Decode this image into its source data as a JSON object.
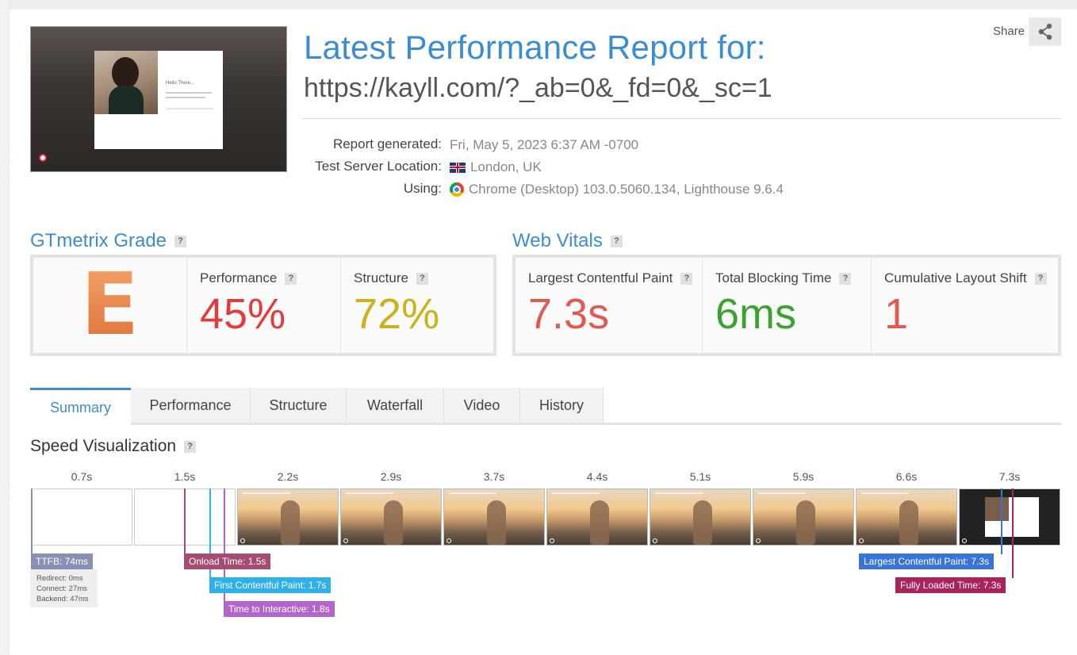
{
  "header": {
    "title": "Latest Performance Report for:",
    "url": "https://kayll.com/?_ab=0&_fd=0&_sc=1",
    "share_label": "Share",
    "thumbnail_text": "Hello There..."
  },
  "meta": {
    "report_generated_label": "Report generated:",
    "report_generated_value": "Fri, May 5, 2023 6:37 AM -0700",
    "location_label": "Test Server Location:",
    "location_value": "London, UK",
    "using_label": "Using:",
    "using_value": "Chrome (Desktop) 103.0.5060.134, Lighthouse 9.6.4"
  },
  "gtmetrix": {
    "title": "GTmetrix Grade",
    "grade": "E",
    "performance_label": "Performance",
    "performance_value": "45%",
    "structure_label": "Structure",
    "structure_value": "72%"
  },
  "web_vitals": {
    "title": "Web Vitals",
    "lcp_label": "Largest Contentful Paint",
    "lcp_value": "7.3s",
    "tbt_label": "Total Blocking Time",
    "tbt_value": "6ms",
    "cls_label": "Cumulative Layout Shift",
    "cls_value": "1"
  },
  "tabs": [
    "Summary",
    "Performance",
    "Structure",
    "Waterfall",
    "Video",
    "History"
  ],
  "speed": {
    "title": "Speed Visualization",
    "frame_times": [
      "0.7s",
      "1.5s",
      "2.2s",
      "2.9s",
      "3.7s",
      "4.4s",
      "5.1s",
      "5.9s",
      "6.6s",
      "7.3s"
    ],
    "ttfb": "TTFB: 74ms",
    "redirect": "Redirect: 0ms",
    "connect": "Connect: 27ms",
    "backend": "Backend: 47ms",
    "onload": "Onload Time: 1.5s",
    "fcp": "First Contentful Paint: 1.7s",
    "tti": "Time to Interactive: 1.8s",
    "lcp": "Largest Contentful Paint: 7.3s",
    "fully_loaded": "Fully Loaded Time: 7.3s"
  },
  "colors": {
    "accent": "#3c8dd0",
    "performance": "#e33b3b",
    "structure": "#c9b21a",
    "lcp": "#e05a52",
    "tbt": "#3aa32d",
    "cls": "#e05a52",
    "ttfb": "#8a8fb5",
    "onload": "#a64b73",
    "fcp": "#2fb0e8",
    "tti": "#b266c9",
    "lcp_marker": "#3a73d6",
    "fully_loaded": "#a9245a"
  }
}
